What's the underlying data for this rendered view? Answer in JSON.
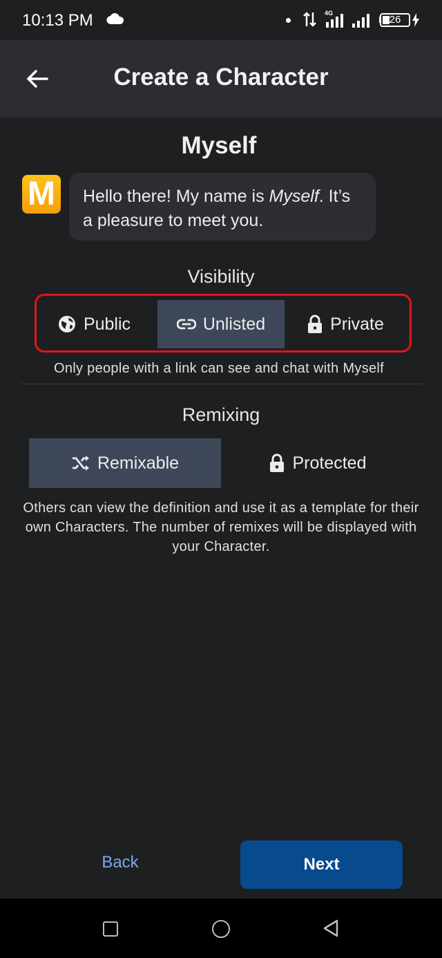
{
  "status_bar": {
    "time": "10:13 PM",
    "battery": "26",
    "icons": [
      "cloud-icon",
      "dot",
      "data-arrows-icon",
      "signal-4g-icon",
      "signal-icon",
      "battery-icon",
      "bolt-icon"
    ]
  },
  "header": {
    "back_icon": "arrow-left-icon",
    "title": "Create a Character"
  },
  "character": {
    "name": "Myself",
    "avatar_letter": "M",
    "greeting_prefix": "Hello there! My name is ",
    "greeting_name": "Myself",
    "greeting_suffix": ". It’s a pleasure to meet you."
  },
  "visibility": {
    "title": "Visibility",
    "options": [
      {
        "label": "Public",
        "icon": "globe-icon",
        "selected": false
      },
      {
        "label": "Unlisted",
        "icon": "link-icon",
        "selected": true
      },
      {
        "label": "Private",
        "icon": "lock-icon",
        "selected": false
      }
    ],
    "description": "Only people with a link can see and chat with Myself"
  },
  "remixing": {
    "title": "Remixing",
    "options": [
      {
        "label": "Remixable",
        "icon": "shuffle-icon",
        "selected": true
      },
      {
        "label": "Protected",
        "icon": "lock-icon",
        "selected": false
      }
    ],
    "description": "Others can view the definition and use it as a template for their own Characters. The number of remixes will be displayed with your Character."
  },
  "footer": {
    "back_label": "Back",
    "next_label": "Next"
  },
  "colors": {
    "background": "#1e1f21",
    "app_bar": "#2b2d31",
    "selected_segment": "#3d4758",
    "primary_button": "#084a8e",
    "link": "#7aa8e8",
    "highlight_border": "#e3141b",
    "avatar": "#f5a623"
  }
}
